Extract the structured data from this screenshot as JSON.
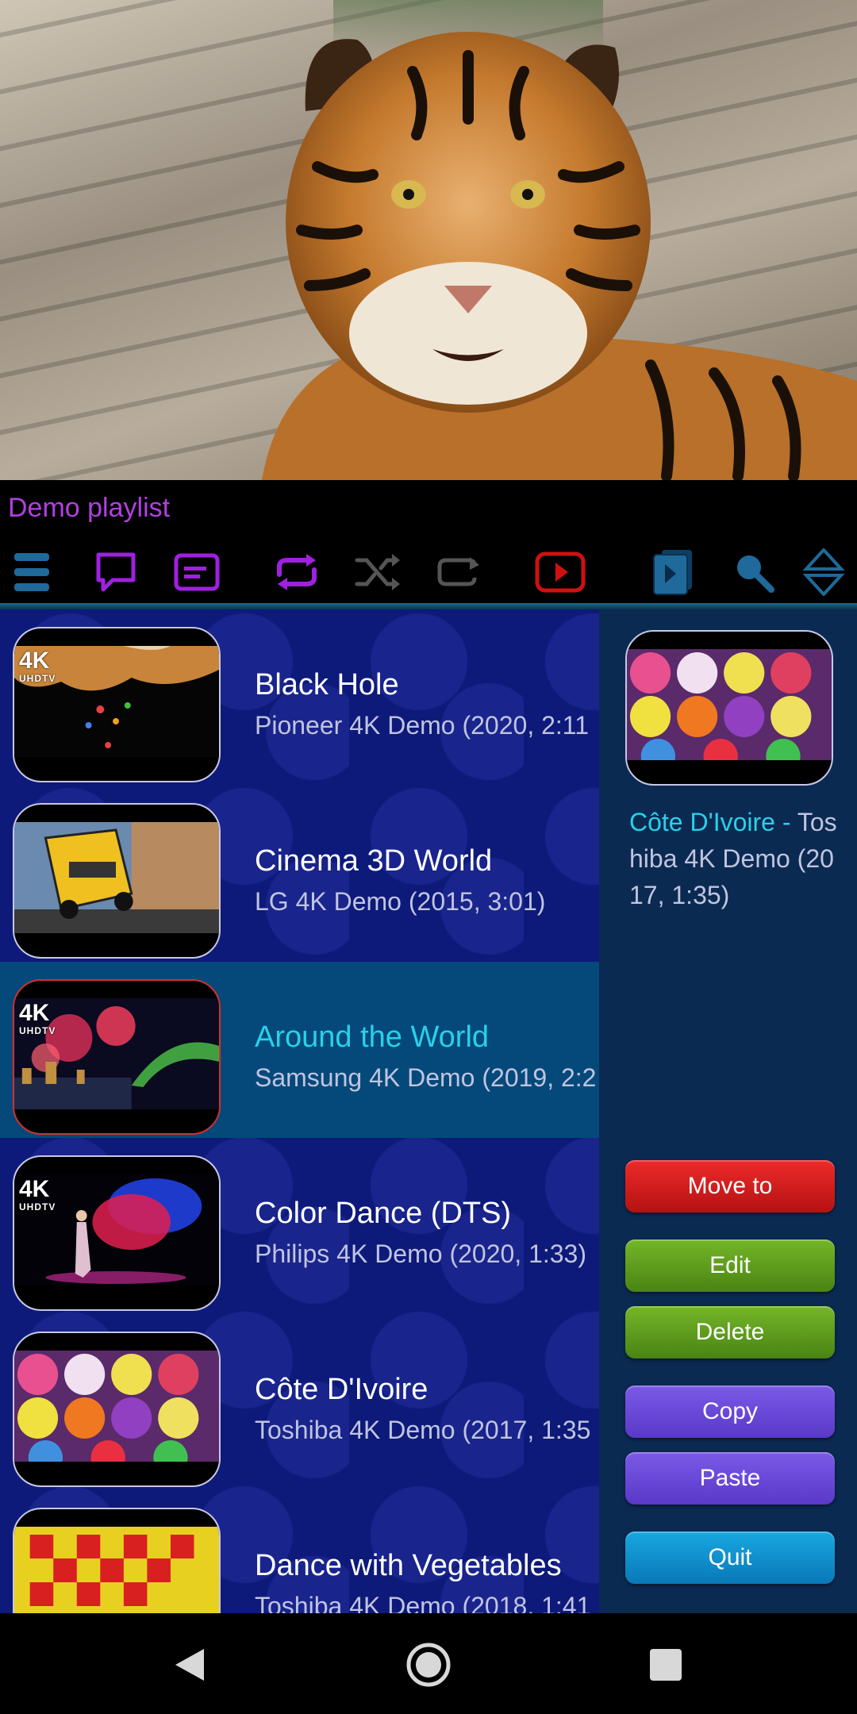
{
  "playlist": {
    "title": "Demo playlist"
  },
  "toolbar": {
    "icons": [
      "menu-icon",
      "chat-icon",
      "subtitle-icon",
      "repeat-icon",
      "shuffle-icon",
      "loop-icon",
      "youtube-icon",
      "play-playlist-icon",
      "search-icon",
      "sort-icon"
    ]
  },
  "items": [
    {
      "title": "Black Hole",
      "subtitle": "Pioneer 4K Demo (2020, 2:11",
      "badge": "4K",
      "badge_sub": "UHDTV"
    },
    {
      "title": "Cinema 3D World",
      "subtitle": "LG 4K Demo (2015, 3:01)",
      "badge": "",
      "badge_sub": ""
    },
    {
      "title": "Around the World",
      "subtitle": "Samsung 4K Demo (2019, 2:2",
      "badge": "4K",
      "badge_sub": "UHDTV"
    },
    {
      "title": "Color Dance (DTS)",
      "subtitle": "Philips 4K Demo (2020, 1:33)",
      "badge": "4K",
      "badge_sub": "UHDTV"
    },
    {
      "title": "Côte D'Ivoire",
      "subtitle": "Toshiba 4K Demo (2017, 1:35",
      "badge": "",
      "badge_sub": ""
    },
    {
      "title": "Dance with Vegetables",
      "subtitle": "Toshiba 4K Demo (2018, 1:41",
      "badge": "",
      "badge_sub": ""
    }
  ],
  "now_playing": {
    "title": "Côte D'Ivoire",
    "separator": " - ",
    "subtitle": "Toshiba 4K Demo (2017, 1:35)"
  },
  "actions": {
    "move_to": "Move  to",
    "edit": "Edit",
    "delete": "Delete",
    "copy": "Copy",
    "paste": "Paste",
    "quit": "Quit"
  },
  "colors": {
    "accent": "#b040e0",
    "highlight": "#2ad0e8",
    "list_bg": "#0d1a7a",
    "selected_bg": "#04497a",
    "panel_bg": "#0b2a52"
  }
}
